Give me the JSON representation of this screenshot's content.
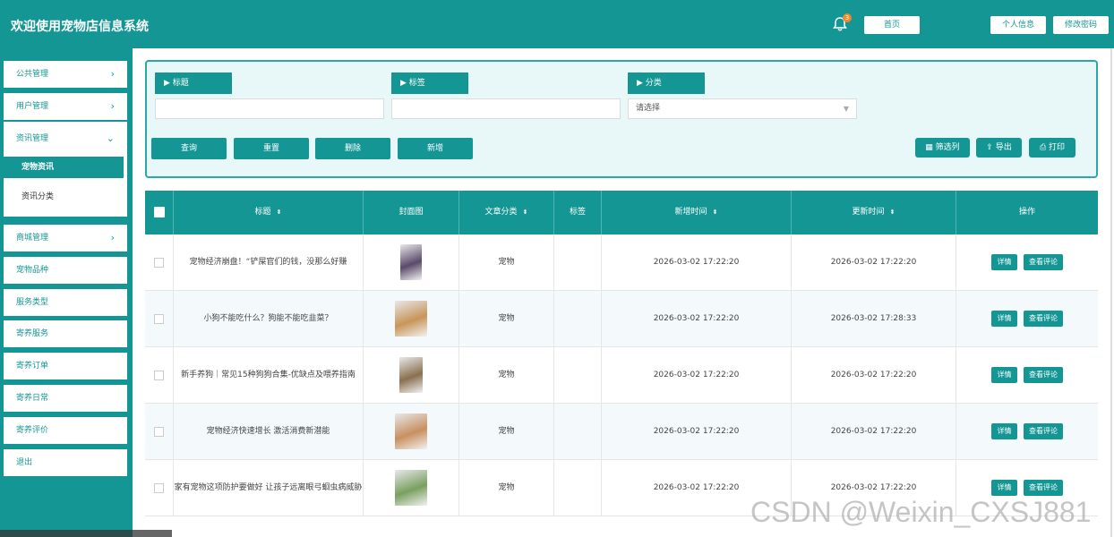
{
  "app": {
    "title": "欢迎使用宠物店信息系统"
  },
  "header": {
    "notification_count": "3",
    "home_label": "首页",
    "profile_label": "个人信息",
    "password_label": "修改密码"
  },
  "sidebar": {
    "items": [
      {
        "label": "公共管理",
        "chevron": "›"
      },
      {
        "label": "用户管理",
        "chevron": "›"
      },
      {
        "label": "资讯管理",
        "chevron": "⌄"
      },
      {
        "label": "商城管理",
        "chevron": "›"
      },
      {
        "label": "宠物品种"
      },
      {
        "label": "服务类型"
      },
      {
        "label": "寄养服务"
      },
      {
        "label": "寄养订单"
      },
      {
        "label": "寄养日常"
      },
      {
        "label": "寄养评价"
      },
      {
        "label": "退出"
      }
    ],
    "submenu": {
      "active": "宠物资讯",
      "other": "资讯分类"
    }
  },
  "filters": {
    "title_label": "▶ 标题",
    "tag_label": "▶ 标签",
    "category_label": "▶ 分类",
    "category_placeholder": "请选择"
  },
  "actions": {
    "query": "查询",
    "reset": "重置",
    "delete": "删除",
    "add": "新增",
    "filter_columns": "筛选列",
    "export": "导出",
    "print": "打印"
  },
  "table": {
    "headers": [
      "标题",
      "封面图",
      "文章分类",
      "标签",
      "新增时间",
      "更新时间",
      "操作"
    ],
    "sort_icon": "⬍",
    "detail_label": "详情",
    "comment_label": "查看评论",
    "rows": [
      {
        "title": "宠物经济崩盘！“铲屎官们的钱，没那么好赚",
        "category": "宠物",
        "tag": "",
        "created": "2026-03-02 17:22:20",
        "updated": "2026-03-02 17:22:20",
        "thumb_color": "#5a4a6a"
      },
      {
        "title": "小狗不能吃什么？狗能不能吃韭菜？",
        "category": "宠物",
        "tag": "",
        "created": "2026-03-02 17:22:20",
        "updated": "2026-03-02 17:28:33",
        "thumb_color": "#c8955a"
      },
      {
        "title": "新手养狗｜常见15种狗狗合集-优缺点及喂养指南",
        "category": "宠物",
        "tag": "",
        "created": "2026-03-02 17:22:20",
        "updated": "2026-03-02 17:22:20",
        "thumb_color": "#8a7050"
      },
      {
        "title": "宠物经济快速增长 激活消费新潜能",
        "category": "宠物",
        "tag": "",
        "created": "2026-03-02 17:22:20",
        "updated": "2026-03-02 17:22:20",
        "thumb_color": "#c89060"
      },
      {
        "title": "家有宠物这项防护要做好 让孩子远离眼弓蛔虫病威胁",
        "category": "宠物",
        "tag": "",
        "created": "2026-03-02 17:22:20",
        "updated": "2026-03-02 17:22:20",
        "thumb_color": "#7aa060"
      }
    ]
  },
  "watermark": "CSDN @Weixin_CXSJ881",
  "colors": {
    "primary": "#149694",
    "panel_bg": "#e8f8f8"
  }
}
